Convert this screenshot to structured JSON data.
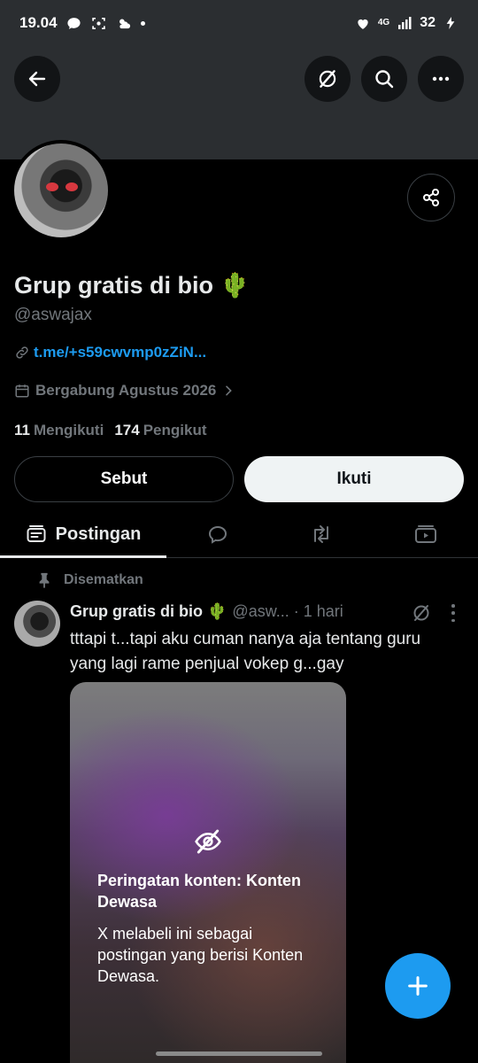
{
  "status_bar": {
    "time": "19.04",
    "network": "4G",
    "battery": "32"
  },
  "profile": {
    "name": "Grup gratis di bio 🌵",
    "handle": "@aswajax",
    "link": "t.me/+s59cwvmp0zZiN...",
    "joined": "Bergabung Agustus 2026",
    "following_count": "11",
    "following_label": "Mengikuti",
    "followers_count": "174",
    "followers_label": "Pengikut"
  },
  "buttons": {
    "mention": "Sebut",
    "follow": "Ikuti"
  },
  "tabs": {
    "posts": "Postingan"
  },
  "post": {
    "pinned_label": "Disematkan",
    "author": "Grup gratis di bio 🌵",
    "meta": "@asw... · 1 hari",
    "text": "tttapi t...tapi aku cuman nanya aja tentang guru yang lagi rame penjual vokep g...gay",
    "warning_title": "Peringatan konten: Konten Dewasa",
    "warning_body": "X melabeli ini sebagai postingan yang berisi Konten Dewasa."
  },
  "colors": {
    "accent": "#1d9bf0",
    "text": "#e7e9ea",
    "muted": "#71767b",
    "banner": "#2b2e31"
  }
}
